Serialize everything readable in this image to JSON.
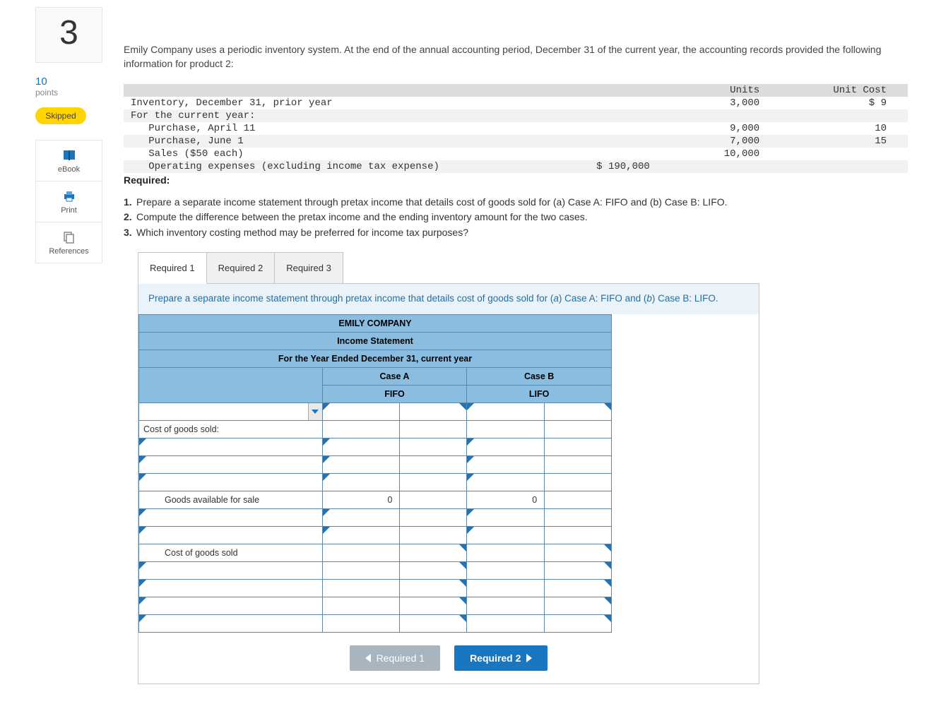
{
  "sidebar": {
    "question_number": "3",
    "points_value": "10",
    "points_label": "points",
    "skipped_badge": "Skipped",
    "tools": {
      "ebook": "eBook",
      "print": "Print",
      "references": "References"
    }
  },
  "problem": {
    "intro": "Emily Company uses a periodic inventory system. At the end of the annual accounting period, December 31 of the current year, the accounting records provided the following information for product 2:",
    "table": {
      "header_units": "Units",
      "header_cost": "Unit Cost",
      "rows": [
        {
          "label": "Inventory, December 31, prior year",
          "units": "3,000",
          "cost": "$ 9",
          "alt": false
        },
        {
          "label": "For the current year:",
          "units": "",
          "cost": "",
          "alt": true
        },
        {
          "label": "   Purchase, April 11",
          "units": "9,000",
          "cost": "10",
          "alt": false
        },
        {
          "label": "   Purchase, June 1",
          "units": "7,000",
          "cost": "15",
          "alt": true
        },
        {
          "label": "   Sales ($50 each)",
          "units": "10,000",
          "cost": "",
          "alt": false
        },
        {
          "label": "   Operating expenses (excluding income tax expense)",
          "amount": "$ 190,000",
          "units": "",
          "cost": "",
          "alt": true
        }
      ]
    },
    "required_heading": "Required:",
    "requirements": [
      "Prepare a separate income statement through pretax income that details cost of goods sold for (a) Case A: FIFO and (b) Case B: LIFO.",
      "Compute the difference between the pretax income and the ending inventory amount for the two cases.",
      "Which inventory costing method may be preferred for income tax purposes?"
    ]
  },
  "tabs": {
    "items": [
      "Required 1",
      "Required 2",
      "Required 3"
    ],
    "active": 0,
    "instruction_pre": "Prepare a separate income statement through pretax income that details cost of goods sold for (",
    "instruction_a": "a",
    "instruction_mid1": ") Case A: FIFO and (",
    "instruction_b": "b",
    "instruction_mid2": ") Case B: LIFO."
  },
  "worksheet": {
    "company": "EMILY COMPANY",
    "title": "Income Statement",
    "period": "For the Year Ended December 31, current year",
    "case_a": "Case A",
    "case_b": "Case B",
    "method_a": "FIFO",
    "method_b": "LIFO",
    "row_cogs_label": "Cost of goods sold:",
    "row_goods_avail": "Goods available for sale",
    "row_goods_avail_a": "0",
    "row_goods_avail_b": "0",
    "row_cogs_total": "Cost of goods sold"
  },
  "nav": {
    "prev": "Required 1",
    "next": "Required 2"
  }
}
